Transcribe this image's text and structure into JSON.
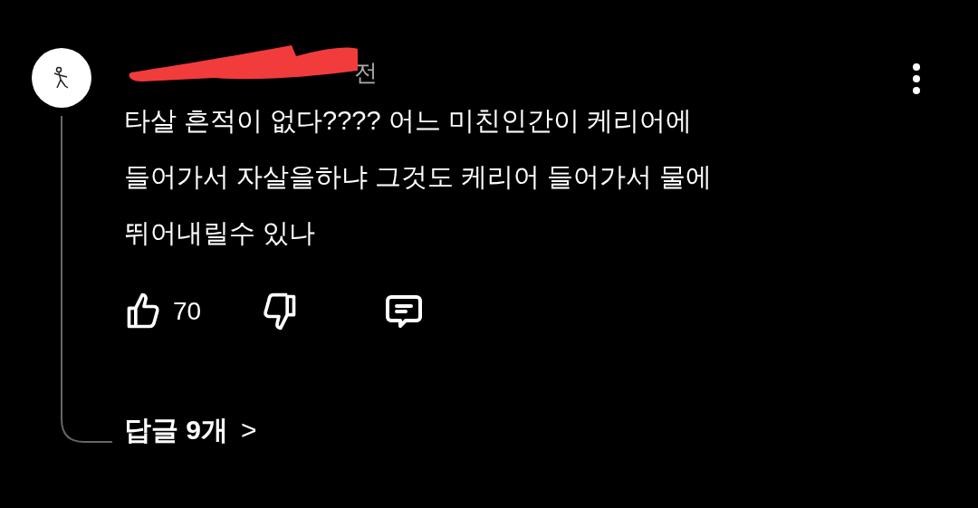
{
  "comment": {
    "header_visible": "전",
    "lines": [
      "타살 흔적이 없다???? 어느 미친인간이 케리어에",
      "들어가서 자살을하냐 그것도 케리어 들어가서 물에",
      "뛰어내릴수 있나"
    ],
    "likes": "70"
  },
  "replies": {
    "label": "답글 9개",
    "chevron": ">"
  }
}
